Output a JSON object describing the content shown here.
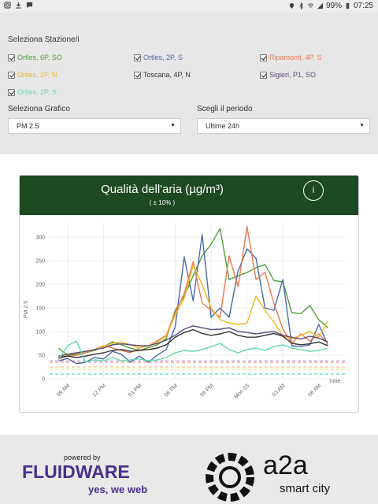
{
  "statusbar": {
    "battery": "99%",
    "time": "07:25"
  },
  "filters": {
    "stations_label": "Seleziona Stazione/i",
    "stations": [
      {
        "label": "Ortles, 6P, SO",
        "color": "#4da03a",
        "checked": true
      },
      {
        "label": "Ortles, 2P, S",
        "color": "#4a6aa8",
        "checked": true
      },
      {
        "label": "Ripamonti, 4P, S",
        "color": "#f07850",
        "checked": true
      },
      {
        "label": "Ortles, 2P, N",
        "color": "#f2b61e",
        "checked": true
      },
      {
        "label": "Toscana, 4P, N",
        "color": "#333333",
        "checked": true
      },
      {
        "label": "Sigieri, P1, SO",
        "color": "#5c4a78",
        "checked": true
      },
      {
        "label": "Ortles, 2P, S",
        "color": "#62d9b0",
        "checked": true
      }
    ],
    "chart_label": "Seleziona Grafico",
    "chart_value": "PM 2.5",
    "period_label": "Scegli il periodo",
    "period_value": "Ultime 24h"
  },
  "card": {
    "title": "Qualità dell'aria (µg/m³)",
    "subtitle": "( ± 10% )",
    "info_label": "i"
  },
  "chart_data": {
    "type": "line",
    "ylabel": "PM 2.5",
    "ylim": [
      0,
      330
    ],
    "yticks": [
      0,
      50,
      100,
      150,
      200,
      250,
      300
    ],
    "xlim": [
      0,
      33
    ],
    "xticks": [
      {
        "x": 2,
        "label": "09 AM"
      },
      {
        "x": 6,
        "label": "12 PM"
      },
      {
        "x": 10,
        "label": "03 PM"
      },
      {
        "x": 14,
        "label": "06 PM"
      },
      {
        "x": 18,
        "label": "09 PM"
      },
      {
        "x": 22,
        "label": "Mon 03"
      },
      {
        "x": 26,
        "label": "03 AM"
      },
      {
        "x": 30,
        "label": "06 AM"
      }
    ],
    "annotation": "Time",
    "threshold_lines": [
      {
        "value": 10,
        "color": "#62d9b0"
      },
      {
        "value": 20,
        "color": "#f5e27a"
      },
      {
        "value": 25,
        "color": "#f7c889"
      },
      {
        "value": 35,
        "color": "#f29a9a"
      },
      {
        "value": 38,
        "color": "#c39ad6"
      }
    ],
    "series": [
      {
        "name": "Ortles, 6P, SO",
        "color": "#4da03a",
        "points": [
          [
            1,
            65
          ],
          [
            2,
            50
          ],
          [
            3,
            52
          ],
          [
            4,
            55
          ],
          [
            5,
            60
          ],
          [
            6,
            68
          ],
          [
            7,
            78
          ],
          [
            8,
            72
          ],
          [
            9,
            65
          ],
          [
            10,
            60
          ],
          [
            11,
            66
          ],
          [
            12,
            72
          ],
          [
            13,
            85
          ],
          [
            14,
            145
          ],
          [
            15,
            175
          ],
          [
            16,
            218
          ],
          [
            17,
            260
          ],
          [
            18,
            285
          ],
          [
            19,
            318
          ],
          [
            20,
            210
          ],
          [
            21,
            218
          ],
          [
            22,
            225
          ],
          [
            23,
            235
          ],
          [
            24,
            242
          ],
          [
            25,
            208
          ],
          [
            26,
            205
          ],
          [
            27,
            140
          ],
          [
            28,
            138
          ],
          [
            29,
            155
          ],
          [
            30,
            125
          ],
          [
            31,
            108
          ]
        ]
      },
      {
        "name": "Ortles, 2P, S",
        "color": "#4a6aa8",
        "points": [
          [
            1,
            38
          ],
          [
            2,
            43
          ],
          [
            3,
            32
          ],
          [
            4,
            35
          ],
          [
            5,
            45
          ],
          [
            6,
            42
          ],
          [
            7,
            58
          ],
          [
            8,
            52
          ],
          [
            9,
            35
          ],
          [
            10,
            48
          ],
          [
            11,
            35
          ],
          [
            12,
            50
          ],
          [
            13,
            62
          ],
          [
            14,
            110
          ],
          [
            15,
            258
          ],
          [
            16,
            165
          ],
          [
            17,
            305
          ],
          [
            18,
            130
          ],
          [
            19,
            150
          ],
          [
            20,
            130
          ],
          [
            21,
            228
          ],
          [
            22,
            275
          ],
          [
            23,
            255
          ],
          [
            24,
            150
          ],
          [
            25,
            145
          ],
          [
            26,
            210
          ],
          [
            27,
            70
          ],
          [
            28,
            68
          ],
          [
            29,
            72
          ],
          [
            30,
            115
          ],
          [
            31,
            72
          ]
        ]
      },
      {
        "name": "Ripamonti, 4P, S",
        "color": "#f07850",
        "points": [
          [
            1,
            42
          ],
          [
            2,
            48
          ],
          [
            3,
            50
          ],
          [
            4,
            55
          ],
          [
            5,
            62
          ],
          [
            6,
            70
          ],
          [
            7,
            65
          ],
          [
            8,
            60
          ],
          [
            9,
            55
          ],
          [
            10,
            65
          ],
          [
            11,
            70
          ],
          [
            12,
            80
          ],
          [
            13,
            92
          ],
          [
            14,
            140
          ],
          [
            15,
            180
          ],
          [
            16,
            248
          ],
          [
            17,
            160
          ],
          [
            18,
            145
          ],
          [
            19,
            130
          ],
          [
            20,
            260
          ],
          [
            21,
            195
          ],
          [
            22,
            322
          ],
          [
            23,
            210
          ],
          [
            24,
            225
          ],
          [
            25,
            160
          ],
          [
            26,
            105
          ],
          [
            27,
            75
          ],
          [
            28,
            95
          ],
          [
            29,
            80
          ],
          [
            30,
            95
          ],
          [
            31,
            75
          ]
        ]
      },
      {
        "name": "Ortles, 2P, N",
        "color": "#f2b61e",
        "points": [
          [
            1,
            45
          ],
          [
            2,
            52
          ],
          [
            3,
            55
          ],
          [
            4,
            58
          ],
          [
            5,
            62
          ],
          [
            6,
            68
          ],
          [
            7,
            75
          ],
          [
            8,
            78
          ],
          [
            9,
            72
          ],
          [
            10,
            65
          ],
          [
            11,
            70
          ],
          [
            12,
            78
          ],
          [
            13,
            90
          ],
          [
            14,
            135
          ],
          [
            15,
            170
          ],
          [
            16,
            240
          ],
          [
            17,
            200
          ],
          [
            18,
            150
          ],
          [
            19,
            125
          ],
          [
            20,
            118
          ],
          [
            21,
            115
          ],
          [
            22,
            118
          ],
          [
            23,
            175
          ],
          [
            24,
            145
          ],
          [
            25,
            120
          ],
          [
            26,
            90
          ],
          [
            27,
            85
          ],
          [
            28,
            92
          ],
          [
            29,
            100
          ],
          [
            30,
            88
          ],
          [
            31,
            122
          ]
        ]
      },
      {
        "name": "Toscana, 4P, N",
        "color": "#333333",
        "points": [
          [
            1,
            45
          ],
          [
            2,
            48
          ],
          [
            3,
            45
          ],
          [
            4,
            48
          ],
          [
            5,
            52
          ],
          [
            6,
            55
          ],
          [
            7,
            60
          ],
          [
            8,
            62
          ],
          [
            9,
            58
          ],
          [
            10,
            60
          ],
          [
            11,
            62
          ],
          [
            12,
            65
          ],
          [
            13,
            72
          ],
          [
            14,
            88
          ],
          [
            15,
            98
          ],
          [
            16,
            104
          ],
          [
            17,
            96
          ],
          [
            18,
            92
          ],
          [
            19,
            95
          ],
          [
            20,
            100
          ],
          [
            21,
            92
          ],
          [
            22,
            88
          ],
          [
            23,
            88
          ],
          [
            24,
            92
          ],
          [
            25,
            96
          ],
          [
            26,
            90
          ],
          [
            27,
            75
          ],
          [
            28,
            72
          ],
          [
            29,
            74
          ],
          [
            30,
            78
          ],
          [
            31,
            70
          ]
        ]
      },
      {
        "name": "Sigieri, P1, SO",
        "color": "#5c4a78",
        "points": [
          [
            1,
            48
          ],
          [
            2,
            52
          ],
          [
            3,
            55
          ],
          [
            4,
            58
          ],
          [
            5,
            62
          ],
          [
            6,
            65
          ],
          [
            7,
            72
          ],
          [
            8,
            74
          ],
          [
            9,
            72
          ],
          [
            10,
            70
          ],
          [
            11,
            70
          ],
          [
            12,
            75
          ],
          [
            13,
            82
          ],
          [
            14,
            92
          ],
          [
            15,
            105
          ],
          [
            16,
            112
          ],
          [
            17,
            108
          ],
          [
            18,
            104
          ],
          [
            19,
            105
          ],
          [
            20,
            108
          ],
          [
            21,
            100
          ],
          [
            22,
            98
          ],
          [
            23,
            95
          ],
          [
            24,
            98
          ],
          [
            25,
            100
          ],
          [
            26,
            92
          ],
          [
            27,
            88
          ],
          [
            28,
            84
          ],
          [
            29,
            90
          ],
          [
            30,
            86
          ],
          [
            31,
            78
          ]
        ]
      },
      {
        "name": "Ortles, 2P, S",
        "color": "#62d9b0",
        "points": [
          [
            1,
            40
          ],
          [
            2,
            70
          ],
          [
            3,
            80
          ],
          [
            4,
            35
          ],
          [
            5,
            40
          ],
          [
            6,
            38
          ],
          [
            7,
            45
          ],
          [
            8,
            38
          ],
          [
            9,
            40
          ],
          [
            10,
            42
          ],
          [
            11,
            38
          ],
          [
            12,
            40
          ],
          [
            13,
            45
          ],
          [
            14,
            55
          ],
          [
            15,
            60
          ],
          [
            16,
            58
          ],
          [
            17,
            62
          ],
          [
            18,
            68
          ],
          [
            19,
            75
          ],
          [
            20,
            62
          ],
          [
            21,
            55
          ],
          [
            22,
            62
          ],
          [
            23,
            65
          ],
          [
            24,
            60
          ],
          [
            25,
            68
          ],
          [
            26,
            72
          ],
          [
            27,
            65
          ],
          [
            28,
            62
          ],
          [
            29,
            58
          ],
          [
            30,
            60
          ],
          [
            31,
            65
          ]
        ]
      }
    ]
  },
  "footer": {
    "powered": "powered by",
    "brand": "FLUIDWARE",
    "tagline": "yes, we web",
    "partner": "a2a",
    "partner_tagline": "smart city"
  }
}
